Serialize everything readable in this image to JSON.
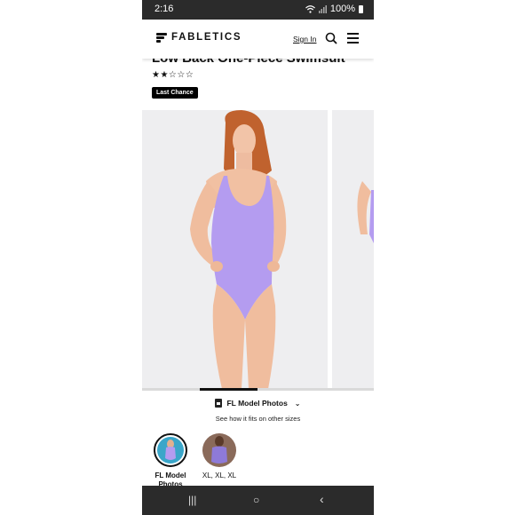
{
  "status": {
    "time": "2:16",
    "battery": "100%"
  },
  "header": {
    "brand": "FABLETICS",
    "signin_label": "Sign In"
  },
  "product": {
    "title": "Low Back One-Piece Swimsuit",
    "rating_stars": "★★☆☆☆",
    "rating": 2,
    "badge": "Last Chance"
  },
  "gallery": {
    "swimsuit_color": "#b49cf0",
    "position": "2 of 4"
  },
  "photos": {
    "dropdown_label": "FL Model Photos",
    "subtitle": "See how it fits on other sizes",
    "thumbs": [
      {
        "label": "FL Model",
        "label2": "Photos",
        "selected": true
      },
      {
        "label": "XL, XL, XL",
        "selected": false
      }
    ]
  },
  "nav": {
    "recent": "|||",
    "home": "○",
    "back": "‹"
  }
}
